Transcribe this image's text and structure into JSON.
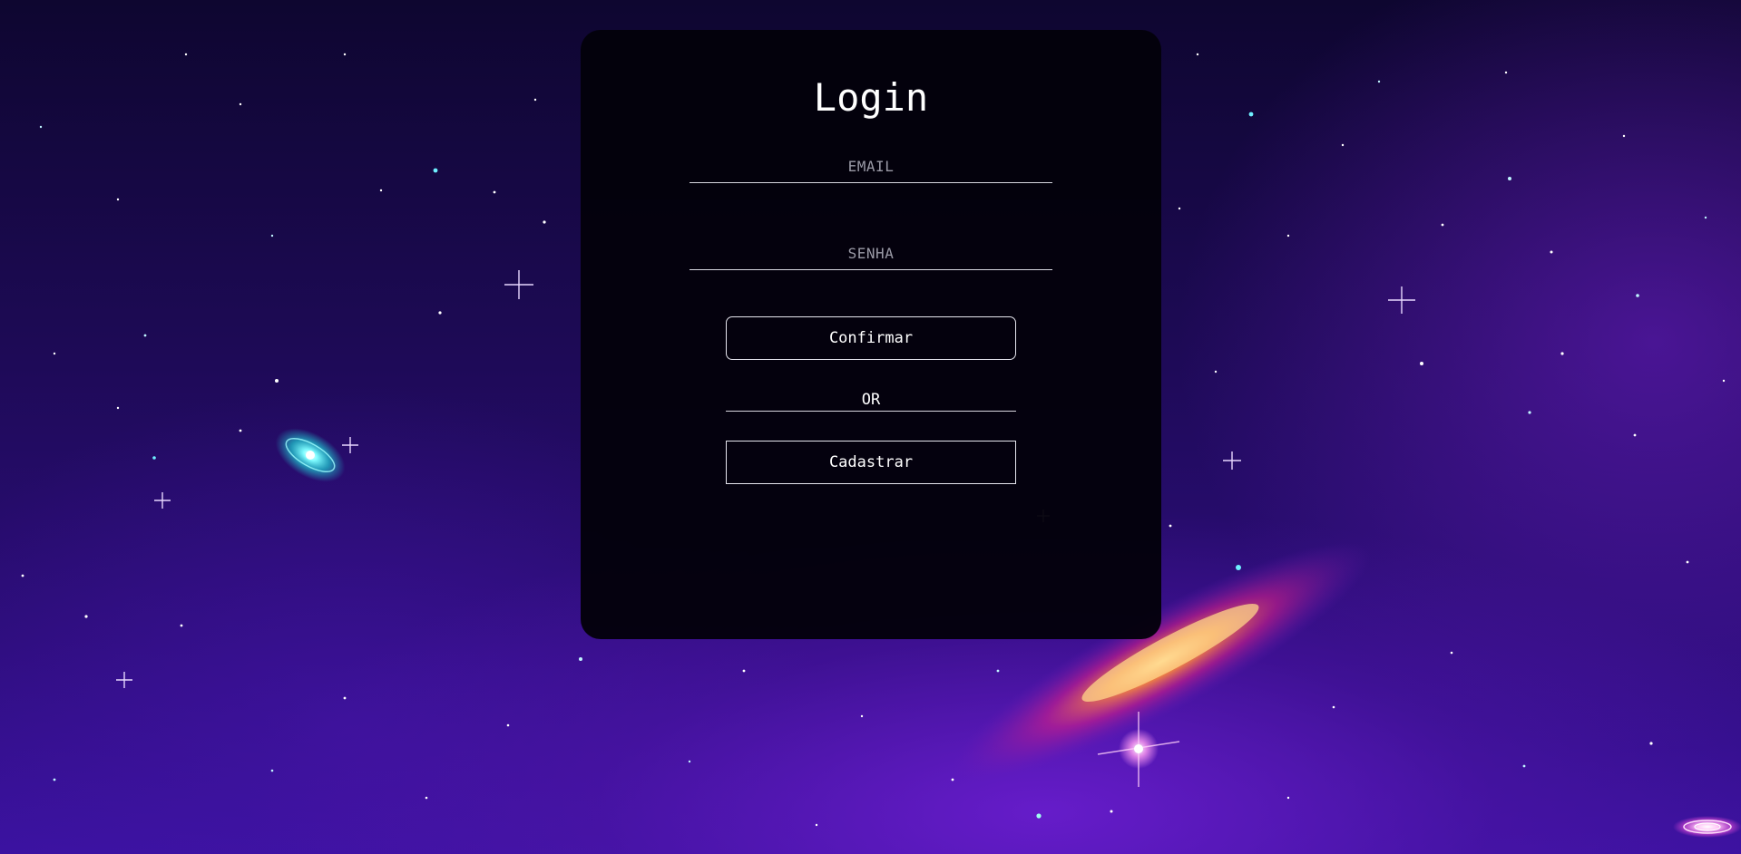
{
  "login": {
    "title": "Login",
    "email_placeholder": "EMAIL",
    "email_value": "",
    "password_placeholder": "SENHA",
    "password_value": "",
    "confirm_label": "Confirmar",
    "divider_label": "OR",
    "register_label": "Cadastrar"
  },
  "theme": {
    "card_background": "#05020d",
    "text_color": "#ffffff",
    "placeholder_color": "#9a9aa6",
    "background_accent": "#5a1fd0"
  }
}
